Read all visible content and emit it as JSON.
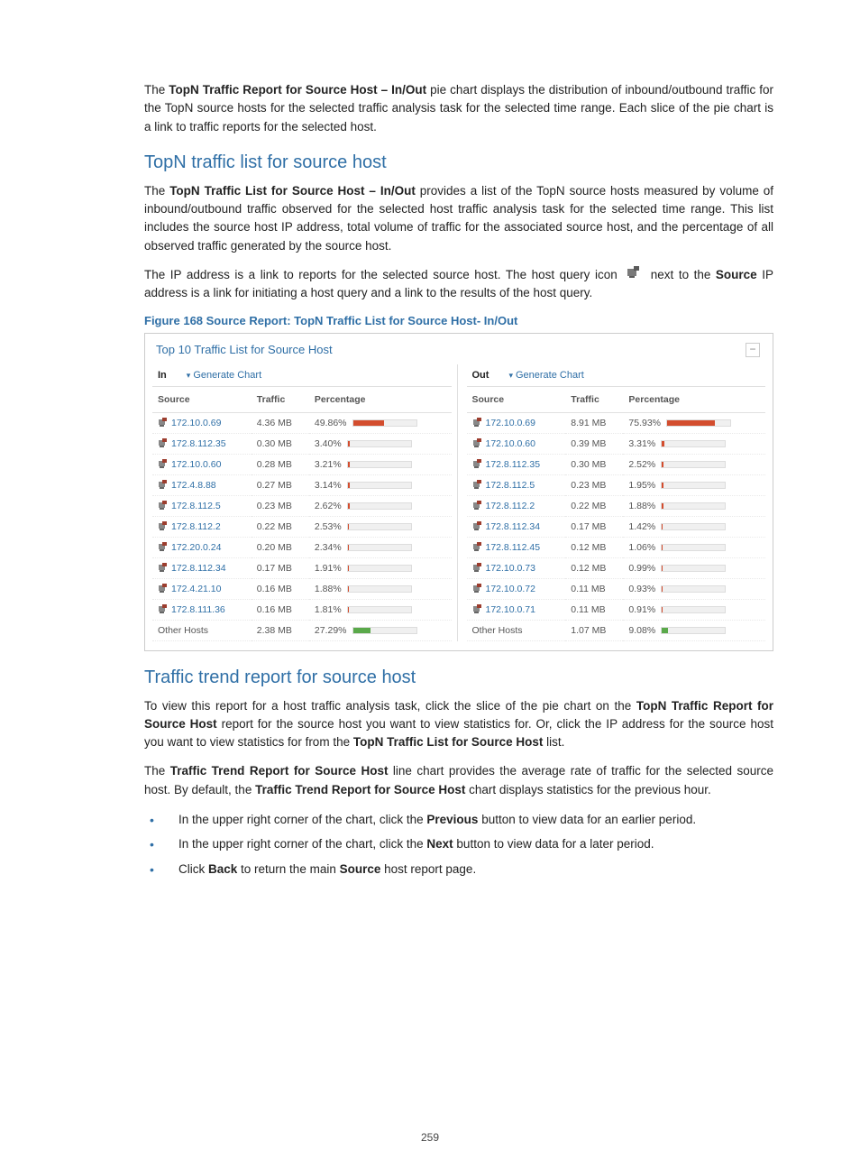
{
  "para1": {
    "prefix": "The ",
    "strong": "TopN Traffic Report for Source Host – In/Out",
    "rest": " pie chart displays the distribution of inbound/outbound traffic for the TopN source hosts for the selected traffic analysis task for the selected time range. Each slice of the pie chart is a link to traffic reports for the selected host."
  },
  "section1_title": "TopN traffic list for source host",
  "para2": {
    "prefix": "The ",
    "strong": "TopN Traffic List for Source Host – In/Out",
    "rest": " provides a list of the TopN source hosts measured by volume of inbound/outbound traffic observed for the selected host traffic analysis task for the selected time range. This list includes the source host IP address, total volume of traffic for the associated source host, and the percentage of all observed traffic generated by the source host."
  },
  "para3": {
    "p1": "The IP address is a link to reports for the selected source host. The host query icon ",
    "p2": " next to the ",
    "strong2": "Source",
    "p3": " IP address is a link for initiating a host query and a link to the results of the host query."
  },
  "figure_caption": "Figure 168 Source Report: TopN Traffic List for Source Host- In/Out",
  "panel": {
    "title": "Top 10 Traffic List for Source Host",
    "collapse": "−",
    "direction_in": "In",
    "direction_out": "Out",
    "generate_chart": "Generate Chart",
    "headers": {
      "source": "Source",
      "traffic": "Traffic",
      "percentage": "Percentage"
    },
    "other_hosts_label": "Other Hosts",
    "in_rows": [
      {
        "ip": "172.10.0.69",
        "traffic": "4.36 MB",
        "pct": "49.86%",
        "fill": 49.86
      },
      {
        "ip": "172.8.112.35",
        "traffic": "0.30 MB",
        "pct": "3.40%",
        "fill": 3.4
      },
      {
        "ip": "172.10.0.60",
        "traffic": "0.28 MB",
        "pct": "3.21%",
        "fill": 3.21
      },
      {
        "ip": "172.4.8.88",
        "traffic": "0.27 MB",
        "pct": "3.14%",
        "fill": 3.14
      },
      {
        "ip": "172.8.112.5",
        "traffic": "0.23 MB",
        "pct": "2.62%",
        "fill": 2.62
      },
      {
        "ip": "172.8.112.2",
        "traffic": "0.22 MB",
        "pct": "2.53%",
        "fill": 2.53
      },
      {
        "ip": "172.20.0.24",
        "traffic": "0.20 MB",
        "pct": "2.34%",
        "fill": 2.34
      },
      {
        "ip": "172.8.112.34",
        "traffic": "0.17 MB",
        "pct": "1.91%",
        "fill": 1.91
      },
      {
        "ip": "172.4.21.10",
        "traffic": "0.16 MB",
        "pct": "1.88%",
        "fill": 1.88
      },
      {
        "ip": "172.8.111.36",
        "traffic": "0.16 MB",
        "pct": "1.81%",
        "fill": 1.81
      }
    ],
    "in_other": {
      "traffic": "2.38 MB",
      "pct": "27.29%",
      "fill": 27.29
    },
    "out_rows": [
      {
        "ip": "172.10.0.69",
        "traffic": "8.91 MB",
        "pct": "75.93%",
        "fill": 75.93
      },
      {
        "ip": "172.10.0.60",
        "traffic": "0.39 MB",
        "pct": "3.31%",
        "fill": 3.31
      },
      {
        "ip": "172.8.112.35",
        "traffic": "0.30 MB",
        "pct": "2.52%",
        "fill": 2.52
      },
      {
        "ip": "172.8.112.5",
        "traffic": "0.23 MB",
        "pct": "1.95%",
        "fill": 1.95
      },
      {
        "ip": "172.8.112.2",
        "traffic": "0.22 MB",
        "pct": "1.88%",
        "fill": 1.88
      },
      {
        "ip": "172.8.112.34",
        "traffic": "0.17 MB",
        "pct": "1.42%",
        "fill": 1.42
      },
      {
        "ip": "172.8.112.45",
        "traffic": "0.12 MB",
        "pct": "1.06%",
        "fill": 1.06
      },
      {
        "ip": "172.10.0.73",
        "traffic": "0.12 MB",
        "pct": "0.99%",
        "fill": 0.99
      },
      {
        "ip": "172.10.0.72",
        "traffic": "0.11 MB",
        "pct": "0.93%",
        "fill": 0.93
      },
      {
        "ip": "172.10.0.71",
        "traffic": "0.11 MB",
        "pct": "0.91%",
        "fill": 0.91
      }
    ],
    "out_other": {
      "traffic": "1.07 MB",
      "pct": "9.08%",
      "fill": 9.08
    }
  },
  "section2_title": "Traffic trend report for source host",
  "para4": {
    "p1": "To view this report for a host traffic analysis task, click the slice of the pie chart on the ",
    "s1": "TopN Traffic Report for Source Host",
    "p2": " report for the source host you want to view statistics for. Or, click the IP address for the source host you want to view statistics for from the ",
    "s2": "TopN Traffic List for Source Host",
    "p3": " list."
  },
  "para5": {
    "p1": "The ",
    "s1": "Traffic Trend Report for Source Host",
    "p2": " line chart provides the average rate of traffic for the selected source host. By default, the ",
    "s2": "Traffic Trend Report for Source Host",
    "p3": " chart displays statistics for the previous hour."
  },
  "bullets": {
    "b1": {
      "p1": "In the upper right corner of the chart, click the ",
      "s": "Previous",
      "p2": " button to view data for an earlier period."
    },
    "b2": {
      "p1": "In the upper right corner of the chart, click the ",
      "s": "Next",
      "p2": " button to view data for a later period."
    },
    "b3": {
      "p1": "Click ",
      "s1": "Back",
      "p2": " to return the main ",
      "s2": "Source",
      "p3": " host report page."
    }
  },
  "page_number": "259"
}
